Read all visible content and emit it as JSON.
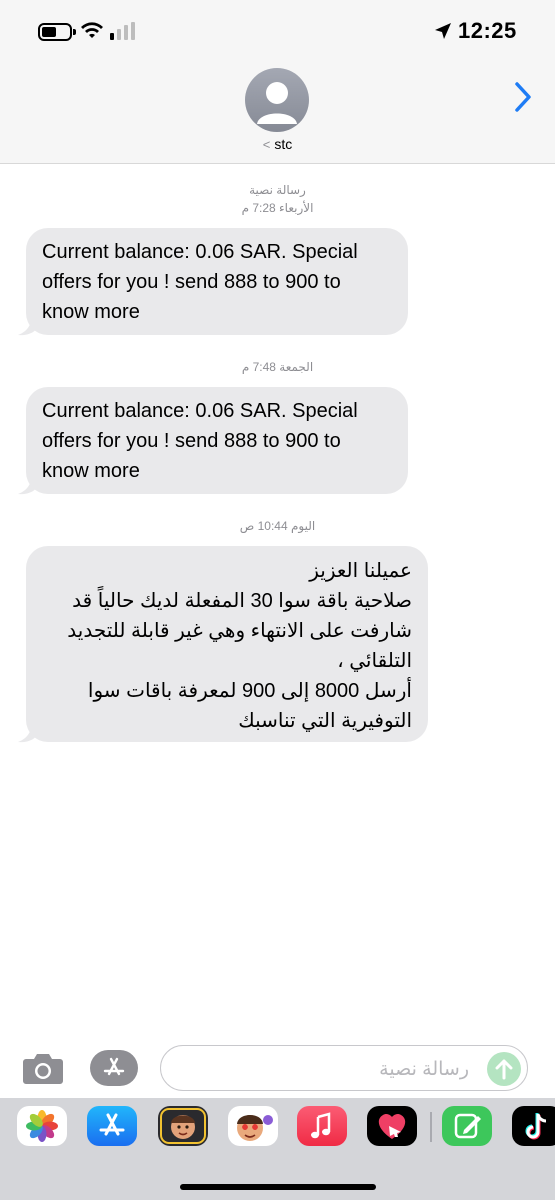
{
  "status_bar": {
    "time": "12:25",
    "icons": [
      "battery-icon",
      "wifi-icon",
      "cellular-signal-icon",
      "location-arrow-icon"
    ]
  },
  "header": {
    "contact_name": "stc",
    "back_glyph": "<",
    "icons": [
      "contact-avatar-icon",
      "chevron-right-icon"
    ]
  },
  "conversation": [
    {
      "timestamp_label": "رسالة نصية",
      "timestamp_time": "الأربعاء 7:28 م",
      "text": "Current balance: 0.06 SAR. Special offers for you ! send 888 to 900 to know more"
    },
    {
      "timestamp_time": "الجمعة 7:48 م",
      "text": "Current balance: 0.06 SAR. Special offers for you ! send 888 to 900 to know more"
    },
    {
      "timestamp_time": "اليوم 10:44 ص",
      "text_lines": [
        "عميلنا العزيز",
        "صلاحية باقة سوا 30 المفعلة لديك حالياً قد",
        "شارفت على الانتهاء وهي غير قابلة للتجديد",
        "التلقائي ،",
        "أرسل 8000 إلى 900 لمعرفة باقات سوا",
        "التوفيرية التي تناسبك"
      ]
    }
  ],
  "compose": {
    "placeholder": "رسالة نصية",
    "icons": [
      "camera-icon",
      "app-store-icon",
      "send-arrow-icon"
    ]
  },
  "app_drawer": {
    "apps": [
      "photos-app-icon",
      "app-store-app-icon",
      "memoji-app-icon",
      "memoji-stickers-app-icon",
      "music-app-icon",
      "heart-digital-touch-icon",
      "notes-app-icon",
      "tiktok-app-icon"
    ]
  },
  "colors": {
    "bubble_gray": "#e9e9eb",
    "ios_blue": "#1e7cf5",
    "timestamp_gray": "#8e8e93",
    "send_green_disabled": "#b4e4c1"
  }
}
